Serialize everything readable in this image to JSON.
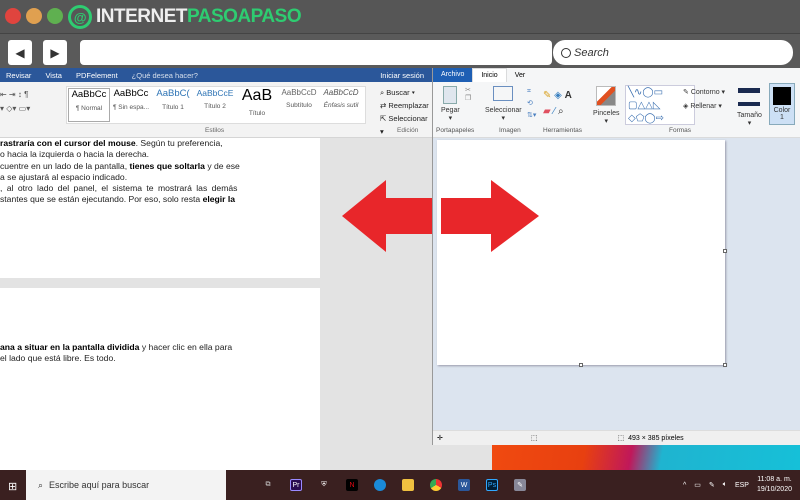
{
  "browser": {
    "logo_left": "INTERNET",
    "logo_right": "PASOAPASO",
    "back": "◀",
    "forward": "▶",
    "search_placeholder": "Search",
    "search_icon": "search-icon"
  },
  "word": {
    "tabs": [
      "Revisar",
      "Vista",
      "PDFelement",
      "¿Qué desea hacer?",
      "Iniciar sesión"
    ],
    "styles": [
      {
        "preview": "AaBbCc",
        "name": "¶ Normal"
      },
      {
        "preview": "AaBbCc",
        "name": "¶ Sin espa..."
      },
      {
        "preview": "AaBbC(",
        "name": "Título 1"
      },
      {
        "preview": "AaBbCcE",
        "name": "Título 2"
      },
      {
        "preview": "AaB",
        "name": "Título"
      },
      {
        "preview": "AaBbCcD",
        "name": "Subtítulo"
      },
      {
        "preview": "AaBbCcD",
        "name": "Énfasis sutil"
      }
    ],
    "groups": {
      "estilos": "Estilos",
      "edicion": "Edición"
    },
    "edit": [
      "Buscar",
      "Reemplazar",
      "Seleccionar"
    ],
    "page1": {
      "l1b": "rastraría con el cursor del mouse",
      "l1": ". Según tu preferencia,",
      "l2": "o hacia la izquierda o hacia la derecha.",
      "l3a": "cuentre en un lado de la pantalla, ",
      "l3b": "tienes que soltarla",
      "l3c": " y de ese",
      "l4": "a se ajustará al espacio indicado.",
      "l5": ", al otro lado del panel, el sistema te mostrará las demás",
      "l6a": "stantes que se están ejecutando. Por eso, solo resta ",
      "l6b": "elegir la"
    },
    "page2": {
      "l1b": "ana a situar en la pantalla dividida",
      "l1": " y hacer clic en ella para",
      "l2": " el lado que está libre. Es todo."
    }
  },
  "paint": {
    "tabs": [
      "Archivo",
      "Inicio",
      "Ver"
    ],
    "tools": {
      "pegar": "Pegar",
      "seleccionar": "Seleccionar",
      "pinceles": "Pinceles",
      "contorno": "Contorno",
      "rellenar": "Rellenar",
      "tamano": "Tamaño",
      "color": "Color",
      "color_num": "1"
    },
    "groups": [
      "Portapapeles",
      "Imagen",
      "Herramientas",
      "Formas"
    ],
    "status_size": "493 × 385 píxeles",
    "accent": "#1e5fb4"
  },
  "taskbar": {
    "search": "Escribe aquí para buscar",
    "lang": "ESP",
    "time": "11:08 a. m.",
    "date": "19/10/2020"
  },
  "colors": {
    "arrow": "#e8262a",
    "word_blue": "#2b579a"
  }
}
